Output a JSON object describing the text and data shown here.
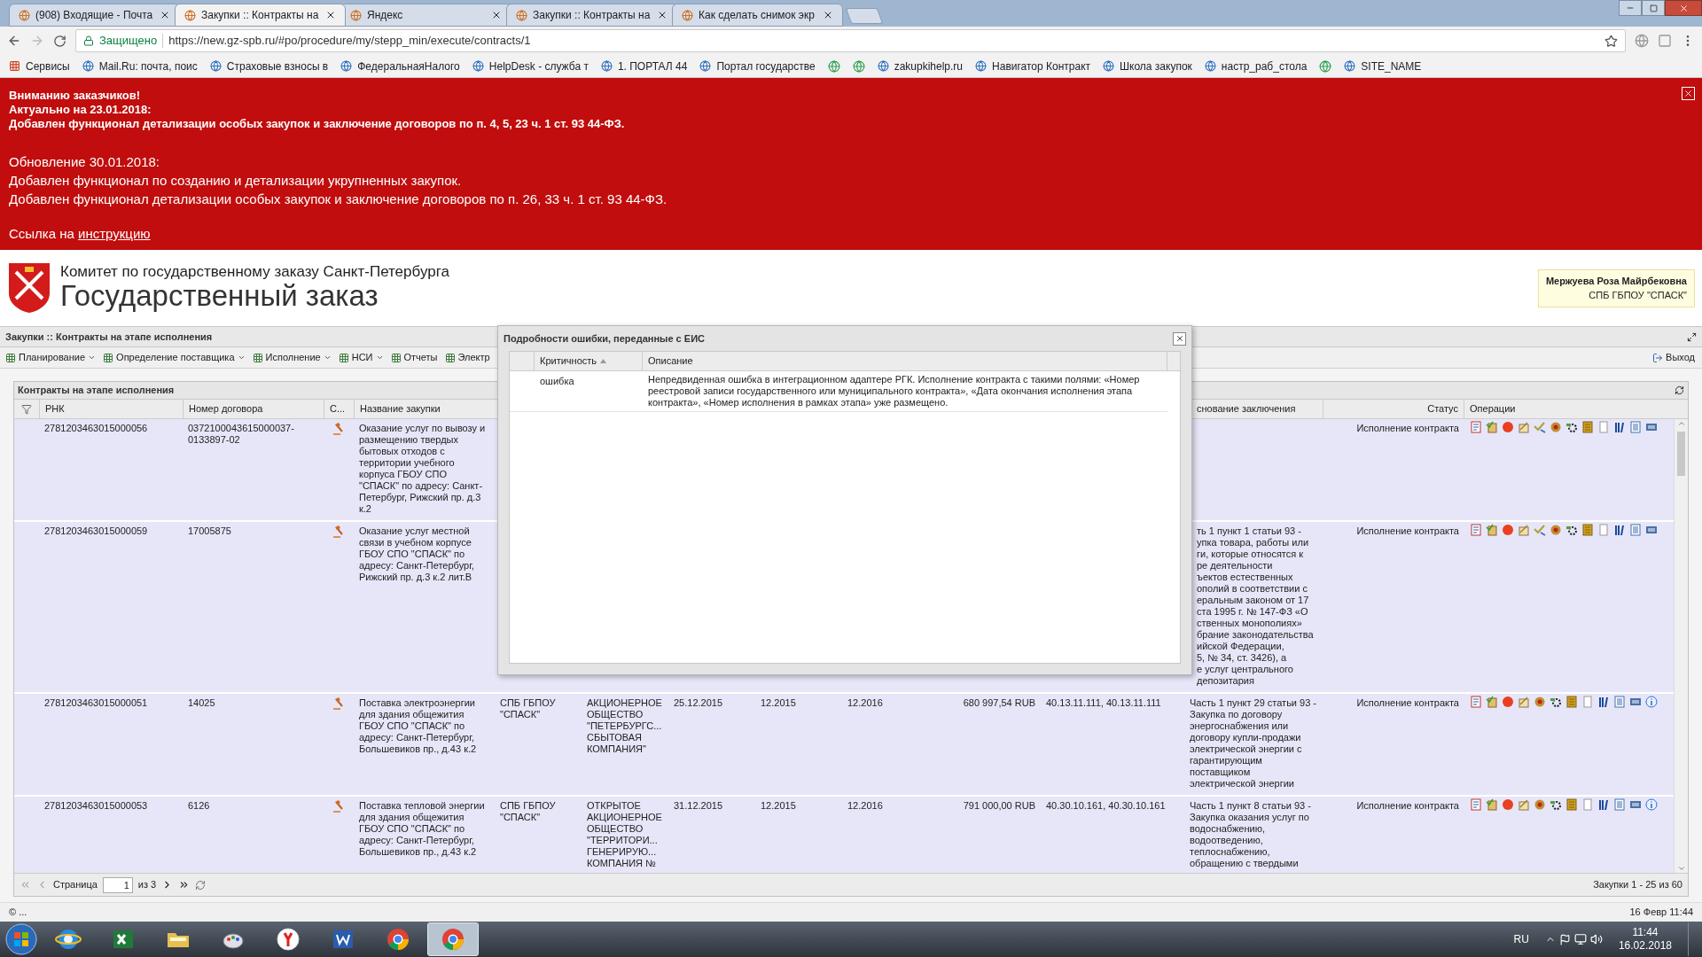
{
  "browser": {
    "tabs": [
      {
        "title": "(908) Входящие - Почта",
        "selected": false
      },
      {
        "title": "Закупки :: Контракты на",
        "selected": true
      },
      {
        "title": "Яндекс",
        "selected": false
      },
      {
        "title": "Закупки :: Контракты на",
        "selected": false
      },
      {
        "title": "Как сделать снимок экр",
        "selected": false
      }
    ],
    "security_label": "Защищено",
    "url": "https://new.gz-spb.ru/#po/procedure/my/stepp_min/execute/contracts/1",
    "bookmarks": [
      {
        "kind": "apps",
        "label": "Сервисы"
      },
      {
        "kind": "link",
        "label": "Mail.Ru: почта, поис"
      },
      {
        "kind": "link",
        "label": "Страховые взносы в"
      },
      {
        "kind": "link",
        "label": "ФедеральнаяНалого"
      },
      {
        "kind": "link",
        "label": "HelpDesk - служба т"
      },
      {
        "kind": "link",
        "label": "1. ПОРТАЛ 44"
      },
      {
        "kind": "link",
        "label": "Портал государстве"
      },
      {
        "kind": "icon"
      },
      {
        "kind": "icon"
      },
      {
        "kind": "link",
        "label": "zakupkihelp.ru"
      },
      {
        "kind": "link",
        "label": "Навигатор Контракт"
      },
      {
        "kind": "link",
        "label": "Школа закупок"
      },
      {
        "kind": "link",
        "label": "настр_раб_стола"
      },
      {
        "kind": "icon"
      },
      {
        "kind": "link",
        "label": "SITE_NAME"
      }
    ]
  },
  "banner": {
    "bold_lines": [
      "Вниманию заказчиков!",
      "Актуально на 23.01.2018:",
      "Добавлен функционал детализации особых закупок и заключение договоров по п. 4, 5, 23 ч. 1 ст. 93 44-ФЗ."
    ],
    "lines": [
      "Обновление 30.01.2018:",
      "Добавлен функционал по созданию и детализации укрупненных закупок.",
      "Добавлен функционал детализации особых закупок и заключение договоров по п. 26, 33 ч. 1 ст. 93 44-ФЗ."
    ],
    "link_prefix": "Ссылка на",
    "link": "инструкцию"
  },
  "header": {
    "subtitle": "Комитет по государственному заказу Санкт-Петербурга",
    "title": "Государственный заказ",
    "user_name": "Мержуева Роза Майрбековна",
    "user_org": "СПБ ГБПОУ \"СПАСК\""
  },
  "panel": {
    "title": "Закупки :: Контракты на этапе исполнения",
    "toolbar": [
      {
        "label": "Планирование",
        "dropdown": true
      },
      {
        "label": "Определение поставщика",
        "dropdown": true
      },
      {
        "label": "Исполнение",
        "dropdown": true
      },
      {
        "label": "НСИ",
        "dropdown": true
      },
      {
        "label": "Отчеты",
        "dropdown": false
      },
      {
        "label": "Электр",
        "dropdown": false
      }
    ],
    "exit": "Выход"
  },
  "grid": {
    "title": "Контракты на этапе исполнения",
    "columns": [
      "РНК",
      "Номер договора",
      "С...",
      "Название закупки",
      "снование заключения",
      "Статус",
      "Операции"
    ],
    "rows": [
      {
        "rnk": "2781203463015000056",
        "number": "0372100043615000037-0133897-02",
        "name": "Оказание услуг по вывозу и размещению твердых бытовых отходов с территории учебного корпуса ГБОУ СПО \"СПАСК\" по адресу: Санкт-Петербург, Рижский пр. д.3 к.2",
        "status": "Исполнение контракта",
        "info_available": false
      },
      {
        "rnk": "2781203463015000059",
        "number": "17005875",
        "name": "Оказание услуг местной связи в учебном корпусе ГБОУ СПО \"СПАСК\" по адресу: Санкт-Петербург, Рижский пр. д.3 к.2 лит.В",
        "basis_lines": [
          "ть 1 пункт 1 статьи 93 -",
          "упка товара, работы или",
          "ги, которые относятся к",
          "ре деятельности",
          "ъектов естественных",
          "ополий в соответствии с",
          "еральным законом от 17",
          "ста 1995 г. № 147-ФЗ «О",
          "ственных монополиях»",
          "брание законодательства",
          "ийской Федерации,",
          "5, № 34, ст. 3426), а",
          "е услуг центрального",
          "депозитария"
        ],
        "status": "Исполнение контракта",
        "info_available": false
      },
      {
        "rnk": "2781203463015000051",
        "number": "14025",
        "name": "Поставка электроэнергии для здания общежития ГБОУ СПО \"СПАСК\" по адресу: Санкт-Петербург, Большевиков пр., д.43 к.2",
        "customer": "СПБ ГБПОУ \"СПАСК\"",
        "supplier_lines": [
          "АКЦИОНЕРНОЕ",
          "ОБЩЕСТВО",
          "\"ПЕТЕРБУРГС...",
          "СБЫТОВАЯ",
          "КОМПАНИЯ\""
        ],
        "date": "25.12.2015",
        "start": "12.2015",
        "end": "12.2016",
        "amount": "680 997,54 RUB",
        "okpd": "40.13.11.111, 40.13.11.111",
        "basis": "Часть 1 пункт 29 статьи 93 - Закупка по договору энергоснабжения или договору купли-продажи электрической энергии с гарантирующим поставщиком электрической энергии",
        "status": "Исполнение контракта",
        "info_available": true
      },
      {
        "rnk": "2781203463015000053",
        "number": "6126",
        "name": "Поставка тепловой энергии для здания общежития ГБОУ СПО \"СПАСК\" по адресу: Санкт-Петербург, Большевиков пр., д.43 к.2",
        "customer": "СПБ ГБПОУ \"СПАСК\"",
        "supplier_lines": [
          "ОТКРЫТОЕ",
          "АКЦИОНЕРНОЕ",
          "ОБЩЕСТВО",
          "\"ТЕРРИТОРИ...",
          "ГЕНЕРИРУЮ...",
          "КОМПАНИЯ №"
        ],
        "date": "31.12.2015",
        "start": "12.2015",
        "end": "12.2016",
        "amount": "791 000,00 RUB",
        "okpd": "40.30.10.161, 40.30.10.161",
        "basis": "Часть 1 пункт 8 статьи 93 - Закупка оказания услуг по водоснабжению, водоотведению, теплоснабжению, обращению с твердыми",
        "status": "Исполнение контракта",
        "info_available": true
      }
    ],
    "pager": {
      "page_label": "Страница",
      "page": "1",
      "of": "из 3",
      "summary": "Закупки 1 - 25 из 60"
    }
  },
  "dialog": {
    "title": "Подробности ошибки, переданные с ЕИС",
    "columns": [
      "Критичность",
      "Описание"
    ],
    "rows": [
      {
        "severity": "ошибка",
        "description": "Непредвиденная ошибка в интеграционном адаптере РГК. Исполнение контракта с такими полями: «Номер реестровой записи государственного или муниципального контракта», «Дата окончания исполнения этапа контракта», «Номер исполнения в рамках этапа» уже размещено."
      }
    ]
  },
  "status_bar": {
    "left": "© ...",
    "right": "16 Февр 11:44"
  },
  "taskbar": {
    "apps": [
      {
        "kind": "ie",
        "selected": false
      },
      {
        "kind": "excel",
        "selected": false
      },
      {
        "kind": "explorer",
        "selected": false
      },
      {
        "kind": "paint",
        "selected": false
      },
      {
        "kind": "yandex",
        "selected": false
      },
      {
        "kind": "word",
        "selected": false
      },
      {
        "kind": "chrome",
        "selected": false
      },
      {
        "kind": "chrome",
        "selected": true
      }
    ],
    "language": "RU",
    "time": "11:44",
    "date": "16.02.2018"
  }
}
